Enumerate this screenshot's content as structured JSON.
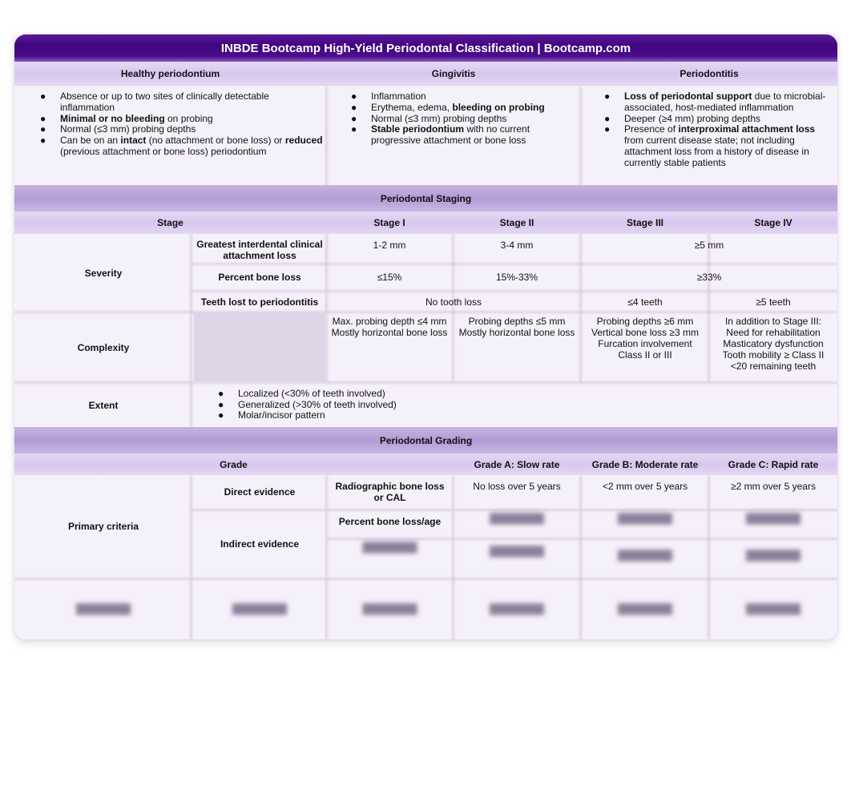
{
  "title": "INBDE Bootcamp High-Yield Periodontal Classification | Bootcamp.com",
  "classification": {
    "headers": [
      "Healthy periodontium",
      "Gingivitis",
      "Periodontitis"
    ],
    "healthy": [
      {
        "pre": "Absence or up to two sites of clinically detectable inflammation"
      },
      {
        "b": "Minimal or no bleeding",
        "post": " on probing"
      },
      {
        "pre": "Normal (≤3 mm) probing depths"
      },
      {
        "pre": "Can be on an ",
        "b": "intact",
        "post": " (no attachment or bone loss) or ",
        "b2": "reduced",
        "post2": " (previous attachment or bone loss) periodontium"
      }
    ],
    "gingivitis": [
      {
        "pre": "Inflammation"
      },
      {
        "pre": "Erythema, edema, ",
        "b": "bleeding on probing"
      },
      {
        "pre": "Normal (≤3 mm) probing depths"
      },
      {
        "b": "Stable periodontium",
        "post": " with no current progressive attachment or bone loss"
      }
    ],
    "periodontitis": [
      {
        "b": "Loss of periodontal support",
        "post": " due to microbial-associated, host-mediated inflammation"
      },
      {
        "pre": "Deeper (≥4 mm) probing depths"
      },
      {
        "pre": "Presence of ",
        "b": "interproximal attachment loss",
        "post": " from current disease state; not including attachment loss from a history of disease in currently stable patients"
      }
    ],
    "bullet_icon": "●"
  },
  "staging": {
    "section_title": "Periodontal Staging",
    "stage_label": "Stage",
    "stages": [
      "Stage I",
      "Stage II",
      "Stage III",
      "Stage IV"
    ],
    "severity_label": "Severity",
    "cal_label": "Greatest interdental clinical attachment loss",
    "cal_values": [
      "1-2 mm",
      "3-4 mm",
      "≥5 mm"
    ],
    "bone_loss_label": "Percent bone loss",
    "bone_loss_values": [
      "≤15%",
      "15%-33%",
      "≥33%"
    ],
    "teeth_lost_label": "Teeth lost to periodontitis",
    "teeth_lost_values": [
      "No tooth loss",
      "≤4 teeth",
      "≥5 teeth"
    ],
    "complexity_label": "Complexity",
    "complexity": [
      [
        "Max. probing depth ≤4 mm",
        "Mostly horizontal bone loss"
      ],
      [
        "Probing depths ≤5 mm",
        "Mostly horizontal bone loss"
      ],
      [
        "Probing depths ≥6 mm",
        "Vertical bone loss ≥3 mm",
        "Furcation involvement",
        "Class II or III"
      ],
      [
        "In addition to Stage III:",
        "Need for rehabilitation",
        "Masticatory dysfunction",
        "Tooth mobility ≥ Class II",
        "<20 remaining teeth"
      ]
    ],
    "extent_label": "Extent",
    "extent": [
      "Localized (<30% of teeth involved)",
      "Generalized (>30% of teeth involved)",
      "Molar/incisor pattern"
    ]
  },
  "grading": {
    "section_title": "Periodontal Grading",
    "grade_label": "Grade",
    "grades": [
      "Grade A: Slow rate",
      "Grade B: Moderate rate",
      "Grade C: Rapid rate"
    ],
    "primary_label": "Primary criteria",
    "direct_label": "Direct evidence",
    "radiographic_label": "Radiographic bone loss or CAL",
    "radiographic_values": [
      "No loss over 5 years",
      "<2 mm over 5 years",
      "≥2 mm over 5 years"
    ],
    "indirect_label": "Indirect evidence",
    "percent_age_label": "Percent bone loss/age",
    "blurred_placeholder": "████████"
  }
}
